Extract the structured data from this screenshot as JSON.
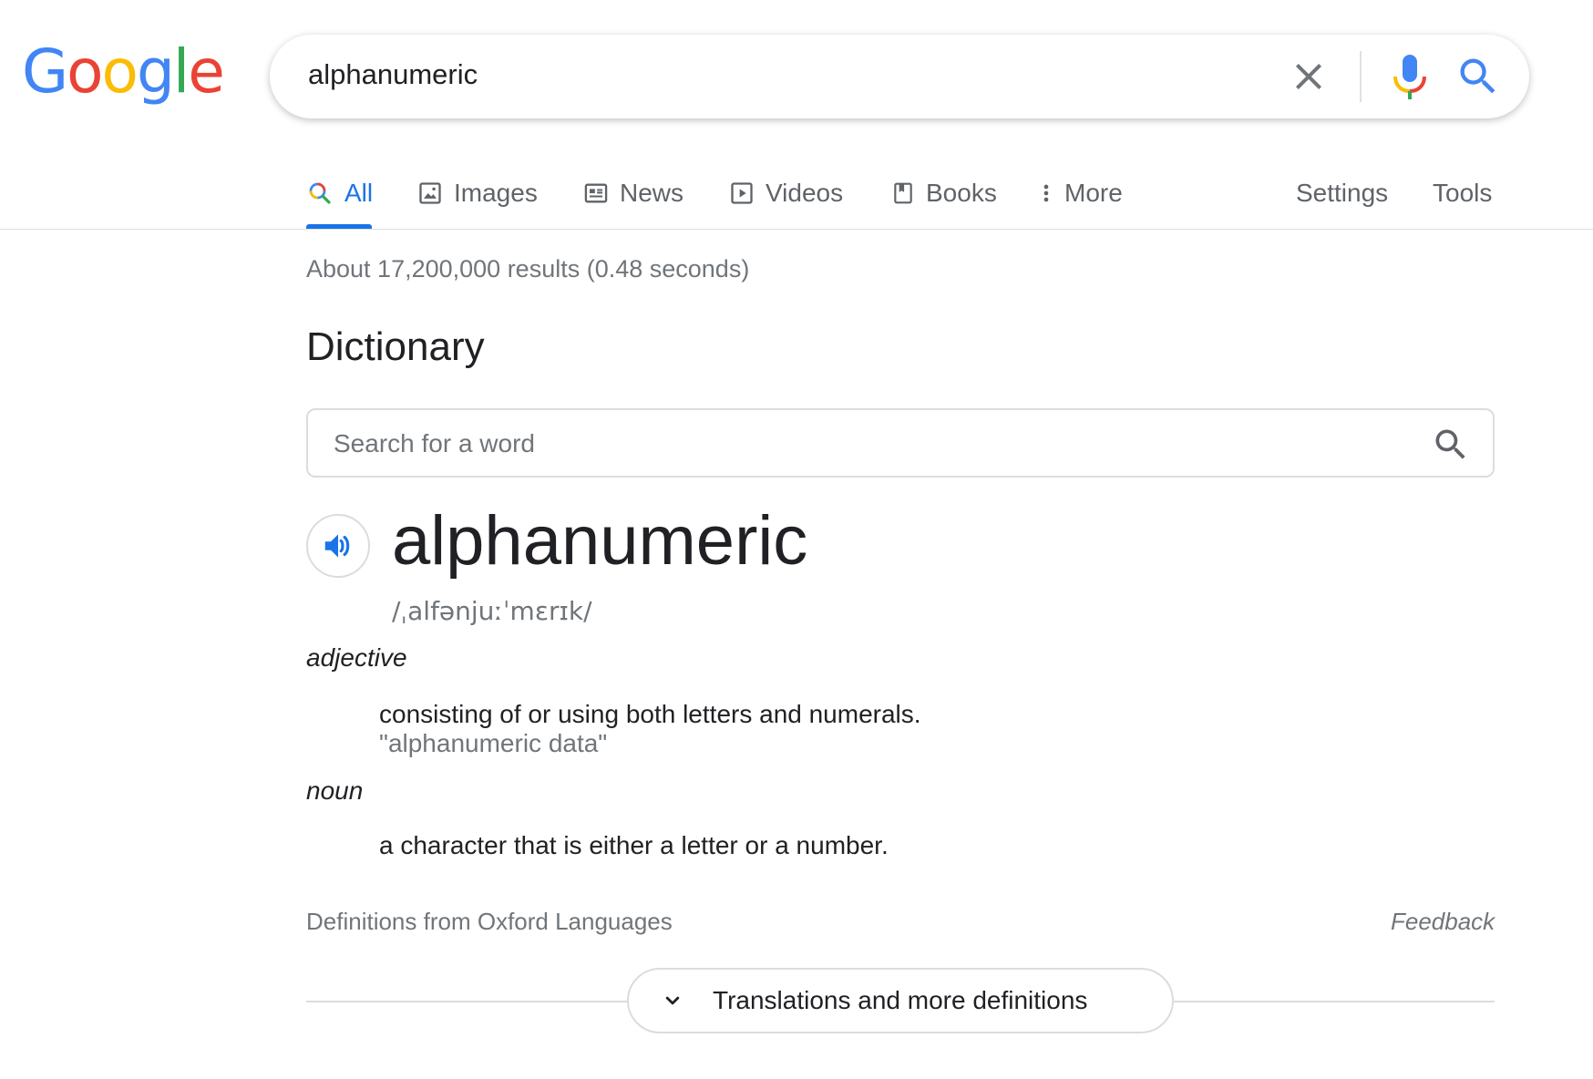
{
  "logo": {
    "letters": [
      "G",
      "o",
      "o",
      "g",
      "l",
      "e"
    ],
    "colors": [
      "#4285f4",
      "#ea4335",
      "#fbbc05",
      "#4285f4",
      "#34a853",
      "#ea4335"
    ]
  },
  "search": {
    "query": "alphanumeric",
    "icons": [
      "close-icon",
      "mic-icon",
      "search-icon"
    ]
  },
  "tabs": [
    {
      "label": "All",
      "icon": "search-icon",
      "active": true
    },
    {
      "label": "Images",
      "icon": "image-icon"
    },
    {
      "label": "News",
      "icon": "news-icon"
    },
    {
      "label": "Videos",
      "icon": "play-icon"
    },
    {
      "label": "Books",
      "icon": "book-icon"
    },
    {
      "label": "More",
      "icon": "more-vert-icon"
    }
  ],
  "tools": {
    "settings": "Settings",
    "tools": "Tools"
  },
  "result_stats": "About 17,200,000 results (0.48 seconds)",
  "dictionary": {
    "heading": "Dictionary",
    "search_placeholder": "Search for a word",
    "word": "alphanumeric",
    "phonetic": "/ˌalfənjuːˈmɛrɪk/",
    "entries": [
      {
        "pos": "adjective",
        "definition": "consisting of or using both letters and numerals.",
        "example": "\"alphanumeric data\""
      },
      {
        "pos": "noun",
        "definition": "a character that is either a letter or a number."
      }
    ],
    "source": "Definitions from Oxford Languages",
    "feedback": "Feedback",
    "more_button": "Translations and more definitions"
  },
  "colors": {
    "accent": "#1a73e8",
    "text": "#202124",
    "muted": "#70757a",
    "border": "#dadce0"
  }
}
